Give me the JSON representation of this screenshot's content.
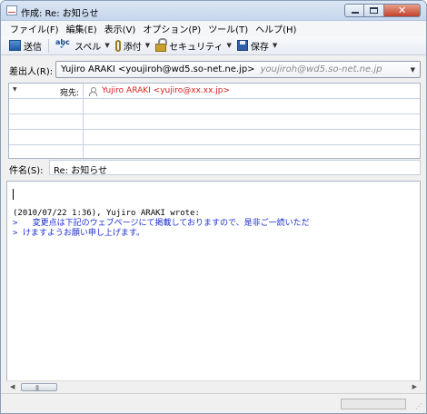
{
  "window": {
    "title": "作成: Re: お知らせ"
  },
  "menu": [
    "ファイル(F)",
    "編集(E)",
    "表示(V)",
    "オプション(P)",
    "ツール(T)",
    "ヘルプ(H)"
  ],
  "toolbar": {
    "send": "送信",
    "spell": "スペル",
    "spell_icon_text": "abc",
    "attach": "添付",
    "security": "セキュリティ",
    "save": "保存"
  },
  "from": {
    "label": "差出人(R):",
    "value": "Yujiro ARAKI <youjiroh@wd5.so-net.ne.jp>",
    "secondary": "youjiroh@wd5.so-net.ne.jp"
  },
  "addressing": {
    "type_label": "宛先:",
    "recipient": "Yujiro ARAKI <yujiro@xx.xx.jp>"
  },
  "subject": {
    "label": "件名(S):",
    "value": "Re: お知らせ"
  },
  "body": {
    "attribution": "(2010/07/22 1:36), Yujiro ARAKI wrote:",
    "quote_line1": ">   変更点は下記のウェブページにて掲載しておりますので、是非ご一読いただ",
    "quote_line2": "> けますようお願い申し上げます。"
  },
  "colors": {
    "recipient_text": "#d42020",
    "quote_text": "#1a2ecc"
  }
}
